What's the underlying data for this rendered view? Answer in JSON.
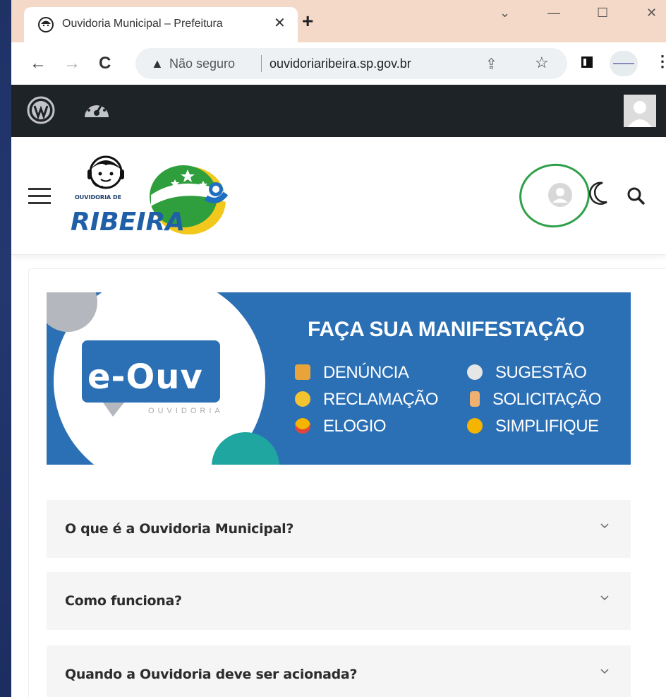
{
  "browser": {
    "tab_title": "Ouvidoria Municipal – Prefeitura",
    "tab_close": "✕",
    "new_tab": "+",
    "window_controls": {
      "dropdown": "⌄",
      "minimize": "—",
      "maximize": "☐",
      "close": "✕"
    },
    "nav": {
      "back": "←",
      "forward": "→",
      "reload": "C"
    },
    "security_warning": "▲",
    "security_text": "Não seguro",
    "url": "ouvidoriaribeira.sp.gov.br",
    "share": "⇪",
    "bookmark": "☆",
    "menu": "⋮"
  },
  "admin_bar": {
    "icons": [
      "wordpress-icon",
      "dashboard-icon",
      "avatar-icon"
    ]
  },
  "header": {
    "logo_text_small": "OUVIDORIA DE",
    "logo_text_big": "RIBEIRA",
    "icons": [
      "menu-icon",
      "user-icon",
      "moon-icon",
      "search-icon"
    ]
  },
  "banner": {
    "brand": "e-Ouv",
    "brand_sub": "OUVIDORIA",
    "title": "FAÇA SUA MANIFESTAÇÃO",
    "items_left": [
      "DENÚNCIA",
      "RECLAMAÇÃO",
      "ELOGIO"
    ],
    "items_right": [
      "SUGESTÃO",
      "SOLICITAÇÃO",
      "SIMPLIFIQUE"
    ],
    "colors": {
      "background": "#2b6fb5",
      "teal": "#1fa6a0",
      "gray": "#b4b7bd"
    }
  },
  "faq": [
    {
      "question": "O que é a Ouvidoria Municipal?"
    },
    {
      "question": "Como funciona?"
    },
    {
      "question": "Quando a Ouvidoria deve ser acionada?"
    }
  ],
  "colors": {
    "tab_strip": "#f5d9c8",
    "admin_bar": "#1d2327",
    "highlight_circle": "#2fa04a",
    "accordion_bg": "#f5f5f5"
  }
}
